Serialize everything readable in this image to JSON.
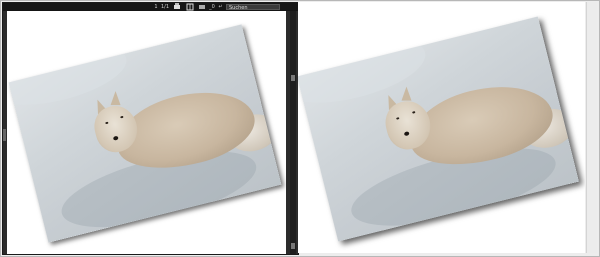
{
  "toolbar": {
    "items": [
      {
        "text": "1",
        "icon": "page-number"
      },
      {
        "text": "1/1",
        "icon": "page-count"
      },
      {
        "text": "",
        "icon": "print-icon"
      },
      {
        "text": "",
        "icon": "grid-icon"
      },
      {
        "text": "",
        "icon": "view-icon"
      },
      {
        "text": "_0",
        "icon": "zoom-level"
      },
      {
        "text": "↵",
        "icon": "return-icon"
      }
    ],
    "search_label": "Suchen"
  },
  "editor": {
    "photo_name": "rotated-dog-photo"
  },
  "preview": {
    "photo_name": "rotated-dog-photo-shadow"
  },
  "colors": {
    "editor_bg": "#2b2b2b",
    "toolbar_bg": "#151515",
    "canvas_bg": "#ffffff",
    "snow": "#cfd5d9",
    "dog_fur": "#c8b69f"
  }
}
